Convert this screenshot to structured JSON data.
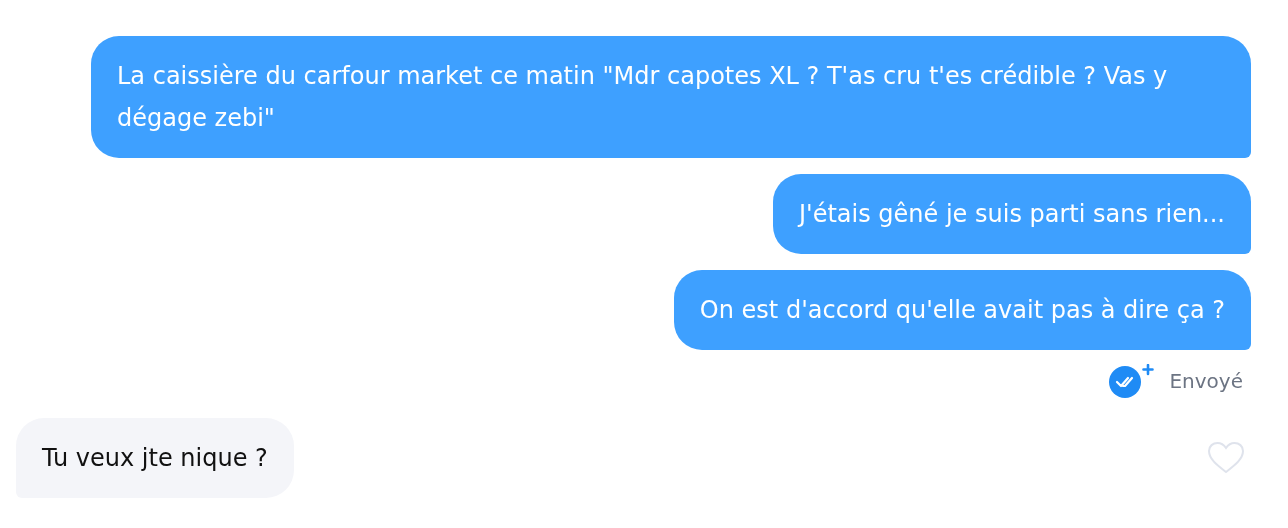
{
  "messages": [
    {
      "kind": "sent",
      "text": "La caissière du carfour market ce matin \"Mdr capotes XL ? T'as cru t'es crédible ? Vas y dégage zebi\""
    },
    {
      "kind": "sent",
      "text": "J'étais gêné je suis parti sans rien..."
    },
    {
      "kind": "sent",
      "text": "On est d'accord qu'elle avait pas à dire ça ?"
    },
    {
      "kind": "status",
      "text": "Envoyé"
    },
    {
      "kind": "received",
      "text": "Tu veux jte nique ?",
      "liked": false
    }
  ]
}
